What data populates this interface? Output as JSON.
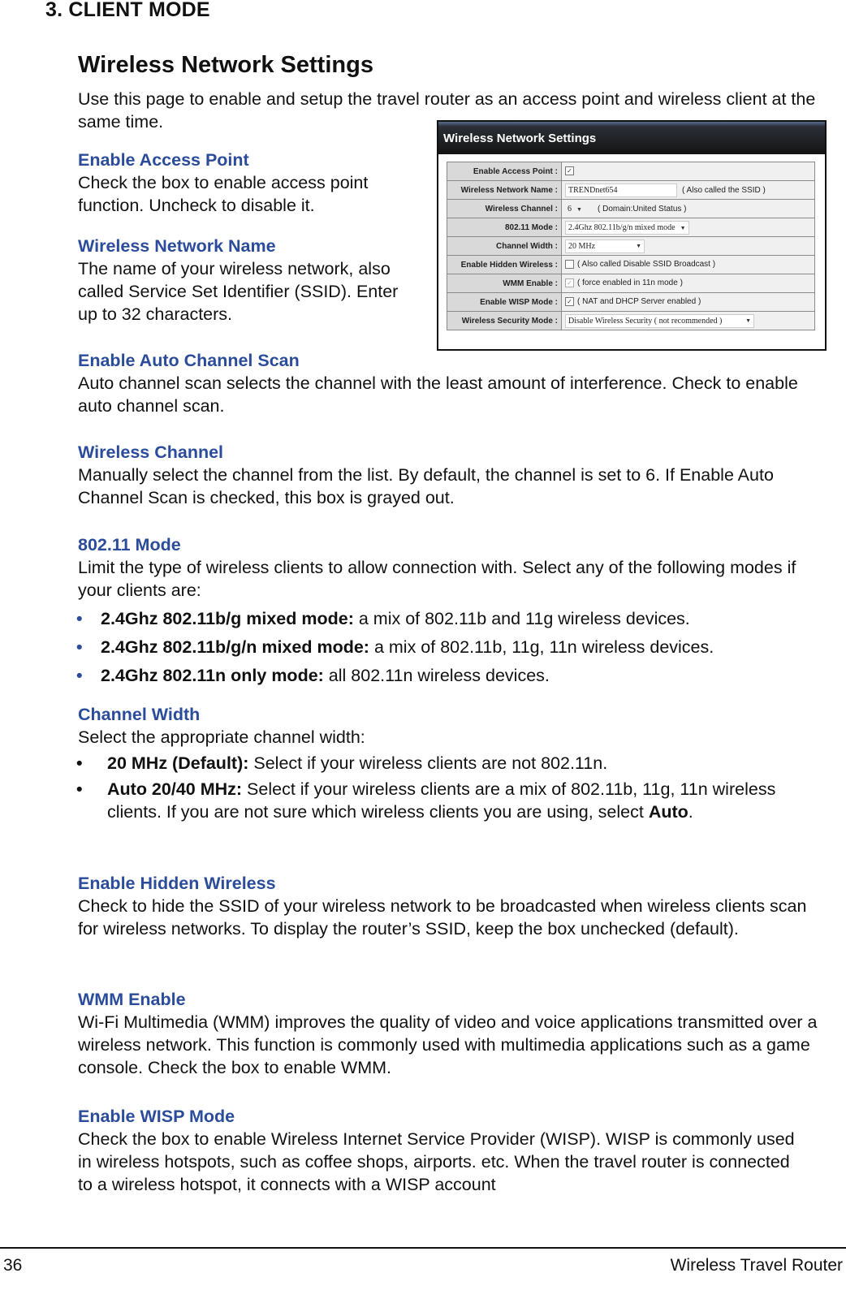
{
  "chapter_heading": "3.  CLIENT MODE",
  "page_title": "Wireless Network Settings",
  "intro": "Use this page to enable and setup the travel router as an access point and wireless client at the same time.",
  "screenshot": {
    "title": "Wireless Network Settings",
    "rows": [
      {
        "label": "Enable Access Point :",
        "checkbox": "☑",
        "value": "",
        "note": ""
      },
      {
        "label": "Wireless Network Name :",
        "value": "TRENDnet654",
        "note": "( Also called the SSID )"
      },
      {
        "label": "Wireless Channel :",
        "value": "6",
        "note": "( Domain:United Status )"
      },
      {
        "label": "802.11 Mode :",
        "value": "2.4Ghz 802.11b/g/n mixed mode",
        "note": ""
      },
      {
        "label": "Channel Width :",
        "value": "20 MHz",
        "note": ""
      },
      {
        "label": "Enable Hidden Wireless :",
        "checkbox": "",
        "note": "( Also called Disable SSID Broadcast )"
      },
      {
        "label": "WMM Enable :",
        "checkbox": "✓",
        "note": "( force enabled in 11n mode )"
      },
      {
        "label": "Enable WISP Mode :",
        "checkbox": "✓",
        "note": "( NAT and DHCP Server enabled )"
      },
      {
        "label": "Wireless Security Mode :",
        "value": "Disable Wireless Security ( not recommended )",
        "note": ""
      }
    ],
    "dropdown_icon": "▼"
  },
  "sections": {
    "enable_ap": {
      "heading": "Enable Access Point",
      "body": "Check the box to enable access point function. Uncheck to disable it."
    },
    "network_name": {
      "heading": "Wireless Network Name",
      "body": "The name of your wireless network, also called Service Set Identifier (SSID). Enter up to 32 characters."
    },
    "auto_channel": {
      "heading": "Enable Auto Channel Scan",
      "body": "Auto channel scan selects the channel with the least amount of interference. Check to enable auto channel scan."
    },
    "channel": {
      "heading": "Wireless Channel",
      "body": "Manually select the channel from the list. By default, the channel is set to 6. If Enable Auto Channel Scan is checked, this box is grayed out."
    },
    "mode": {
      "heading": "802.11 Mode",
      "body": "Limit the type of wireless clients to allow connection with. Select any of the following modes if your clients are:",
      "bullets": [
        {
          "bold": "2.4Ghz 802.11b/g mixed mode:",
          "text": " a mix of 802.11b and 11g wireless devices."
        },
        {
          "bold": "2.4Ghz 802.11b/g/n mixed mode:",
          "text": " a mix of 802.11b, 11g, 11n wireless devices."
        },
        {
          "bold": "2.4Ghz 802.11n only mode:",
          "text": " all 802.11n wireless devices."
        }
      ]
    },
    "width": {
      "heading": "Channel Width",
      "body": "Select the appropriate channel width:",
      "bullets": [
        {
          "bold": "20 MHz (Default):",
          "text": " Select if your wireless clients are not 802.11n."
        },
        {
          "bold": "Auto 20/40 MHz:",
          "text": " Select if your wireless clients are a mix of 802.11b, 11g, 11n wireless clients. If you are not sure which wireless clients you are using, select ",
          "bold2": "Auto",
          "text2": "."
        }
      ]
    },
    "hidden": {
      "heading": "Enable Hidden Wireless",
      "body": "Check to hide the SSID of your wireless network to be broadcasted when wireless clients scan for wireless networks. To display the router’s SSID, keep the box unchecked (default)."
    },
    "wmm": {
      "heading": "WMM Enable",
      "body": "Wi-Fi Multimedia (WMM) improves the quality of video and voice applications transmitted over a wireless network. This function is commonly used with multimedia applications such as a game console. Check the box to enable WMM."
    },
    "wisp": {
      "heading": "Enable WISP Mode",
      "body": "Check the box to enable Wireless Internet Service Provider (WISP). WISP is commonly used in wireless hotspots, such as coffee shops, airports. etc. When the travel router is connected to a wireless hotspot, it connects with a WISP account"
    }
  },
  "footer": {
    "page_number": "36",
    "product": "Wireless Travel Router"
  },
  "colors": {
    "heading_blue": "#2b4c9a"
  }
}
